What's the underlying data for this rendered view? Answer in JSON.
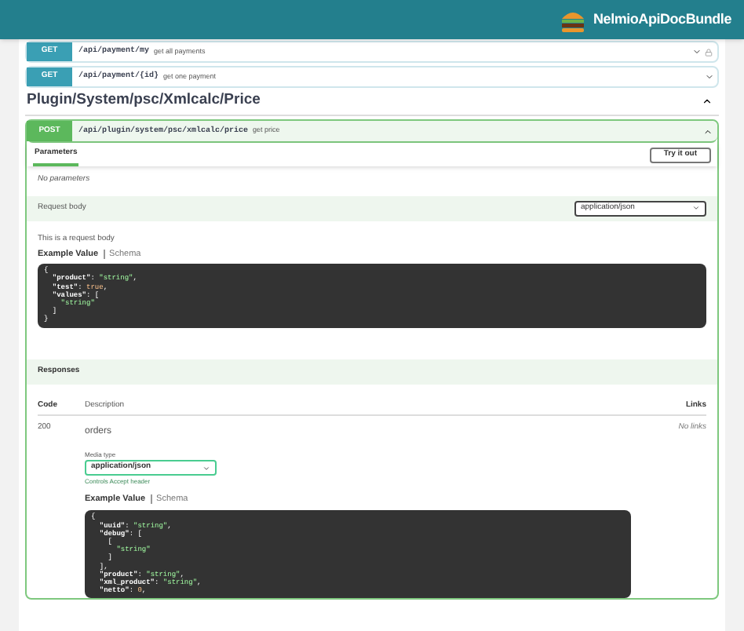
{
  "header": {
    "brand": "NelmioApiDocBundle"
  },
  "operations": [
    {
      "method": "GET",
      "path": "/api/payment/my",
      "summary": "get all payments",
      "locked": true
    },
    {
      "method": "GET",
      "path": "/api/payment/{id}",
      "summary": "get one payment",
      "locked": false
    }
  ],
  "section": {
    "title": "Plugin/System/psc/Xmlcalc/Price",
    "expanded": true
  },
  "operation": {
    "method": "POST",
    "path": "/api/plugin/system/psc/xmlcalc/price",
    "summary": "get price",
    "expanded": true,
    "parameters_tab": "Parameters",
    "try_button": "Try it out",
    "no_parameters": "No parameters",
    "request_body_label": "Request body",
    "request_content_type": "application/json",
    "request_description": "This is a request body",
    "request_example_tabs": [
      {
        "label": "Example Value",
        "selected": true
      },
      {
        "label": "Schema",
        "selected": false
      }
    ],
    "request_example": [
      [
        {
          "t": "{",
          "kind": "p"
        }
      ],
      [
        {
          "t": "  \"product\"",
          "kind": "key"
        },
        {
          "t": ": ",
          "kind": "p"
        },
        {
          "t": "\"string\"",
          "kind": "str"
        },
        {
          "t": ",",
          "kind": "p"
        }
      ],
      [
        {
          "t": "  \"test\"",
          "kind": "key"
        },
        {
          "t": ": ",
          "kind": "p"
        },
        {
          "t": "true",
          "kind": "lit"
        },
        {
          "t": ",",
          "kind": "p"
        }
      ],
      [
        {
          "t": "  \"values\"",
          "kind": "key"
        },
        {
          "t": ": [",
          "kind": "p"
        }
      ],
      [
        {
          "t": "    \"string\"",
          "kind": "str"
        }
      ],
      [
        {
          "t": "  ]",
          "kind": "p"
        }
      ],
      [
        {
          "t": "}",
          "kind": "p"
        }
      ]
    ],
    "responses_label": "Responses",
    "responses_columns": [
      "Code",
      "Description",
      "Links"
    ],
    "responses": [
      {
        "code": "200",
        "description": "orders",
        "links": "No links",
        "media_type_label": "Media type",
        "media_type": "application/json",
        "media_hint": "Controls Accept header",
        "example_tabs": [
          {
            "label": "Example Value",
            "selected": true
          },
          {
            "label": "Schema",
            "selected": false
          }
        ],
        "example": [
          [
            {
              "t": "{",
              "kind": "p"
            }
          ],
          [
            {
              "t": "  \"uuid\"",
              "kind": "key"
            },
            {
              "t": ": ",
              "kind": "p"
            },
            {
              "t": "\"string\"",
              "kind": "str"
            },
            {
              "t": ",",
              "kind": "p"
            }
          ],
          [
            {
              "t": "  \"debug\"",
              "kind": "key"
            },
            {
              "t": ": [",
              "kind": "p"
            }
          ],
          [
            {
              "t": "    [",
              "kind": "p"
            }
          ],
          [
            {
              "t": "      \"string\"",
              "kind": "str"
            }
          ],
          [
            {
              "t": "    ]",
              "kind": "p"
            }
          ],
          [
            {
              "t": "  ],",
              "kind": "p"
            }
          ],
          [
            {
              "t": "  \"product\"",
              "kind": "key"
            },
            {
              "t": ": ",
              "kind": "p"
            },
            {
              "t": "\"string\"",
              "kind": "str"
            },
            {
              "t": ",",
              "kind": "p"
            }
          ],
          [
            {
              "t": "  \"xml_product\"",
              "kind": "key"
            },
            {
              "t": ": ",
              "kind": "p"
            },
            {
              "t": "\"string\"",
              "kind": "str"
            },
            {
              "t": ",",
              "kind": "p"
            }
          ],
          [
            {
              "t": "  \"netto\"",
              "kind": "key"
            },
            {
              "t": ": ",
              "kind": "p"
            },
            {
              "t": "0",
              "kind": "lit"
            },
            {
              "t": ",",
              "kind": "p"
            }
          ]
        ]
      }
    ]
  }
}
